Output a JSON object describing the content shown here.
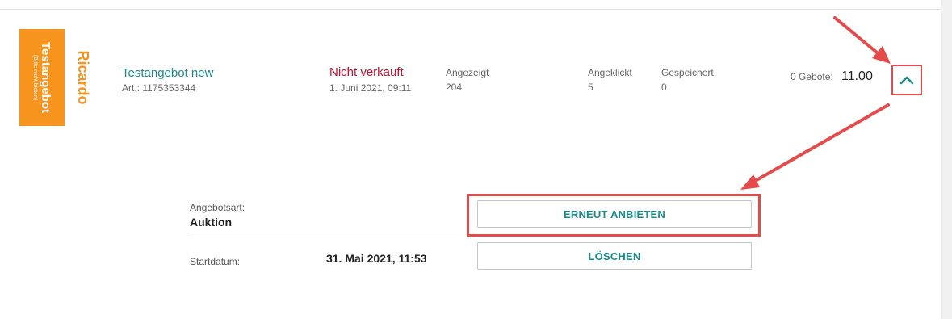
{
  "listing": {
    "thumbnail": {
      "title": "Testangebot",
      "subtitle": "(Bitte nicht bieten)",
      "color": "#f7941d"
    },
    "brand": "Ricardo",
    "title": "Testangebot new",
    "article": "Art.: 1175353344",
    "status": "Nicht verkauft",
    "status_date": "1. Juni 2021, 09:11",
    "stats": [
      {
        "label": "Angezeigt",
        "value": "204"
      },
      {
        "label": "Angeklickt",
        "value": "5"
      },
      {
        "label": "Gespeichert",
        "value": "0"
      }
    ],
    "bids_label": "0 Gebote:",
    "price": "11.00",
    "expand_icon": "chevron-up-icon"
  },
  "details": {
    "offer_type_label": "Angebotsart:",
    "offer_type_value": "Auktion",
    "start_label": "Startdatum:",
    "start_value": "31. Mai 2021, 11:53"
  },
  "actions": {
    "relist_label": "ERNEUT ANBIETEN",
    "delete_label": "LÖSCHEN"
  },
  "colors": {
    "accent": "#1a8a8a",
    "status_red": "#c8102e",
    "brand_orange": "#f7941d",
    "annotation_red": "#e54b4b"
  }
}
